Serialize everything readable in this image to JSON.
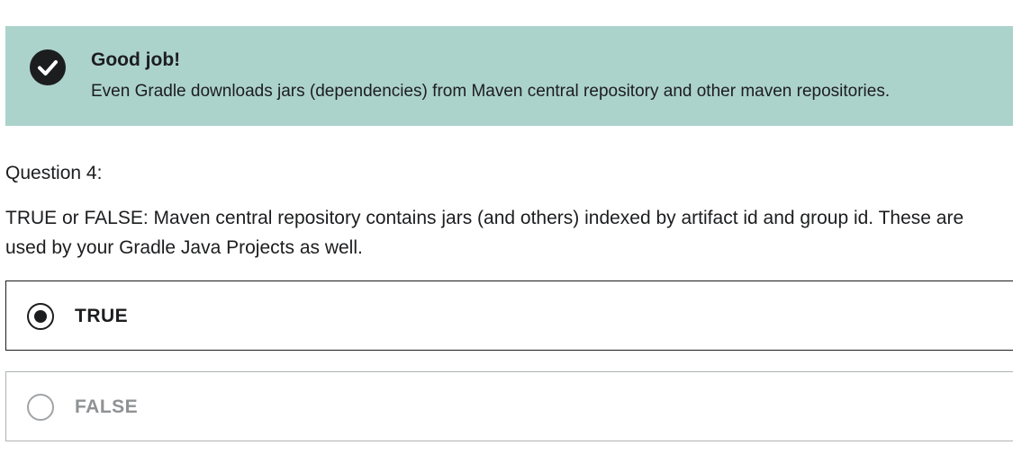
{
  "feedback": {
    "icon": "check-circle-icon",
    "title": "Good job!",
    "message": "Even Gradle downloads jars (dependencies) from Maven central repository and other maven repositories.",
    "background_color": "#acd2cc"
  },
  "question": {
    "number_label": "Question 4:",
    "text": "TRUE or FALSE: Maven central repository contains jars (and others) indexed by artifact id and group id. These are used by your Gradle Java Projects as well."
  },
  "options": [
    {
      "label": "TRUE",
      "selected": true
    },
    {
      "label": "FALSE",
      "selected": false
    }
  ]
}
